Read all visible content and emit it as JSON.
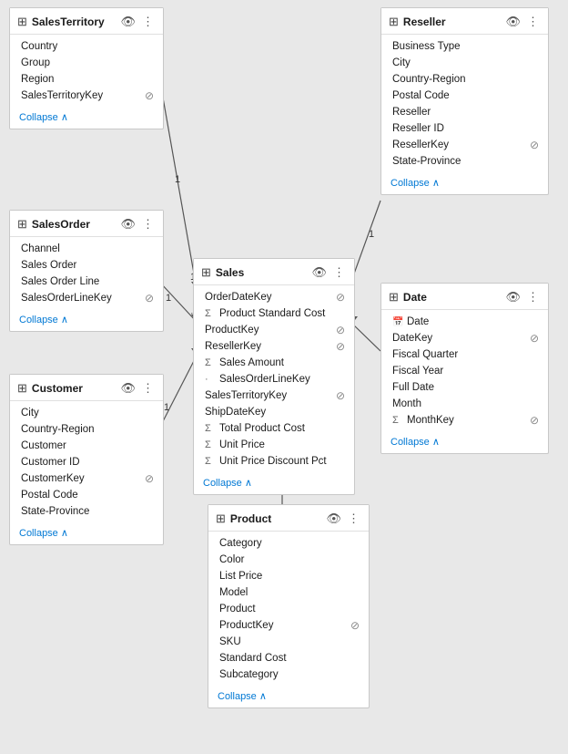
{
  "tables": {
    "salesTerritory": {
      "title": "SalesTerritory",
      "icon": "⊞",
      "fields": [
        {
          "name": "Country",
          "prefix": "",
          "key": false
        },
        {
          "name": "Group",
          "prefix": "",
          "key": false
        },
        {
          "name": "Region",
          "prefix": "",
          "key": false
        },
        {
          "name": "SalesTerritoryKey",
          "prefix": "",
          "key": true
        }
      ],
      "collapse": "Collapse"
    },
    "salesOrder": {
      "title": "SalesOrder",
      "icon": "⊞",
      "fields": [
        {
          "name": "Channel",
          "prefix": "",
          "key": false
        },
        {
          "name": "Sales Order",
          "prefix": "",
          "key": false
        },
        {
          "name": "Sales Order Line",
          "prefix": "",
          "key": false
        },
        {
          "name": "SalesOrderLineKey",
          "prefix": "",
          "key": true
        }
      ],
      "collapse": "Collapse"
    },
    "customer": {
      "title": "Customer",
      "icon": "⊞",
      "fields": [
        {
          "name": "City",
          "prefix": "",
          "key": false
        },
        {
          "name": "Country-Region",
          "prefix": "",
          "key": false
        },
        {
          "name": "Customer",
          "prefix": "",
          "key": false
        },
        {
          "name": "Customer ID",
          "prefix": "",
          "key": false
        },
        {
          "name": "CustomerKey",
          "prefix": "",
          "key": true
        },
        {
          "name": "Postal Code",
          "prefix": "",
          "key": false
        },
        {
          "name": "State-Province",
          "prefix": "",
          "key": false
        }
      ],
      "collapse": "Collapse"
    },
    "sales": {
      "title": "Sales",
      "icon": "⊞",
      "fields": [
        {
          "name": "OrderDateKey",
          "prefix": "",
          "key": true
        },
        {
          "name": "Product Standard Cost",
          "prefix": "Σ",
          "key": false
        },
        {
          "name": "ProductKey",
          "prefix": "",
          "key": true
        },
        {
          "name": "ResellerKey",
          "prefix": "",
          "key": true
        },
        {
          "name": "Sales Amount",
          "prefix": "Σ",
          "key": false
        },
        {
          "name": "SalesOrderLineKey",
          "prefix": "·",
          "key": false
        },
        {
          "name": "SalesTerritoryKey",
          "prefix": "",
          "key": true
        },
        {
          "name": "ShipDateKey",
          "prefix": "",
          "key": false
        },
        {
          "name": "Total Product Cost",
          "prefix": "Σ",
          "key": false
        },
        {
          "name": "Unit Price",
          "prefix": "Σ",
          "key": false
        },
        {
          "name": "Unit Price Discount Pct",
          "prefix": "Σ",
          "key": false
        }
      ],
      "collapse": "Collapse"
    },
    "reseller": {
      "title": "Reseller",
      "icon": "⊞",
      "fields": [
        {
          "name": "Business Type",
          "prefix": "",
          "key": false
        },
        {
          "name": "City",
          "prefix": "",
          "key": false
        },
        {
          "name": "Country-Region",
          "prefix": "",
          "key": false
        },
        {
          "name": "Postal Code",
          "prefix": "",
          "key": false
        },
        {
          "name": "Reseller",
          "prefix": "",
          "key": false
        },
        {
          "name": "Reseller ID",
          "prefix": "",
          "key": false
        },
        {
          "name": "ResellerKey",
          "prefix": "",
          "key": true
        },
        {
          "name": "State-Province",
          "prefix": "",
          "key": false
        }
      ],
      "collapse": "Collapse"
    },
    "date": {
      "title": "Date",
      "icon": "⊞",
      "fields": [
        {
          "name": "Date",
          "prefix": "📅",
          "key": false
        },
        {
          "name": "DateKey",
          "prefix": "",
          "key": true
        },
        {
          "name": "Fiscal Quarter",
          "prefix": "",
          "key": false
        },
        {
          "name": "Fiscal Year",
          "prefix": "",
          "key": false
        },
        {
          "name": "Full Date",
          "prefix": "",
          "key": false
        },
        {
          "name": "Month",
          "prefix": "",
          "key": false
        },
        {
          "name": "MonthKey",
          "prefix": "Σ",
          "key": true
        }
      ],
      "collapse": "Collapse"
    },
    "product": {
      "title": "Product",
      "icon": "⊞",
      "fields": [
        {
          "name": "Category",
          "prefix": "",
          "key": false
        },
        {
          "name": "Color",
          "prefix": "",
          "key": false
        },
        {
          "name": "List Price",
          "prefix": "",
          "key": false
        },
        {
          "name": "Model",
          "prefix": "",
          "key": false
        },
        {
          "name": "Product",
          "prefix": "",
          "key": false
        },
        {
          "name": "ProductKey",
          "prefix": "",
          "key": true
        },
        {
          "name": "SKU",
          "prefix": "",
          "key": false
        },
        {
          "name": "Standard Cost",
          "prefix": "",
          "key": false
        },
        {
          "name": "Subcategory",
          "prefix": "",
          "key": false
        }
      ],
      "collapse": "Collapse"
    }
  },
  "labels": {
    "eyeIcon": "👁",
    "moreIcon": "⋮",
    "collapseArrow": "∧",
    "keyIcon": "🔑",
    "hiddenIcon": "⊘",
    "one": "1",
    "dot": "·",
    "star": "*"
  }
}
